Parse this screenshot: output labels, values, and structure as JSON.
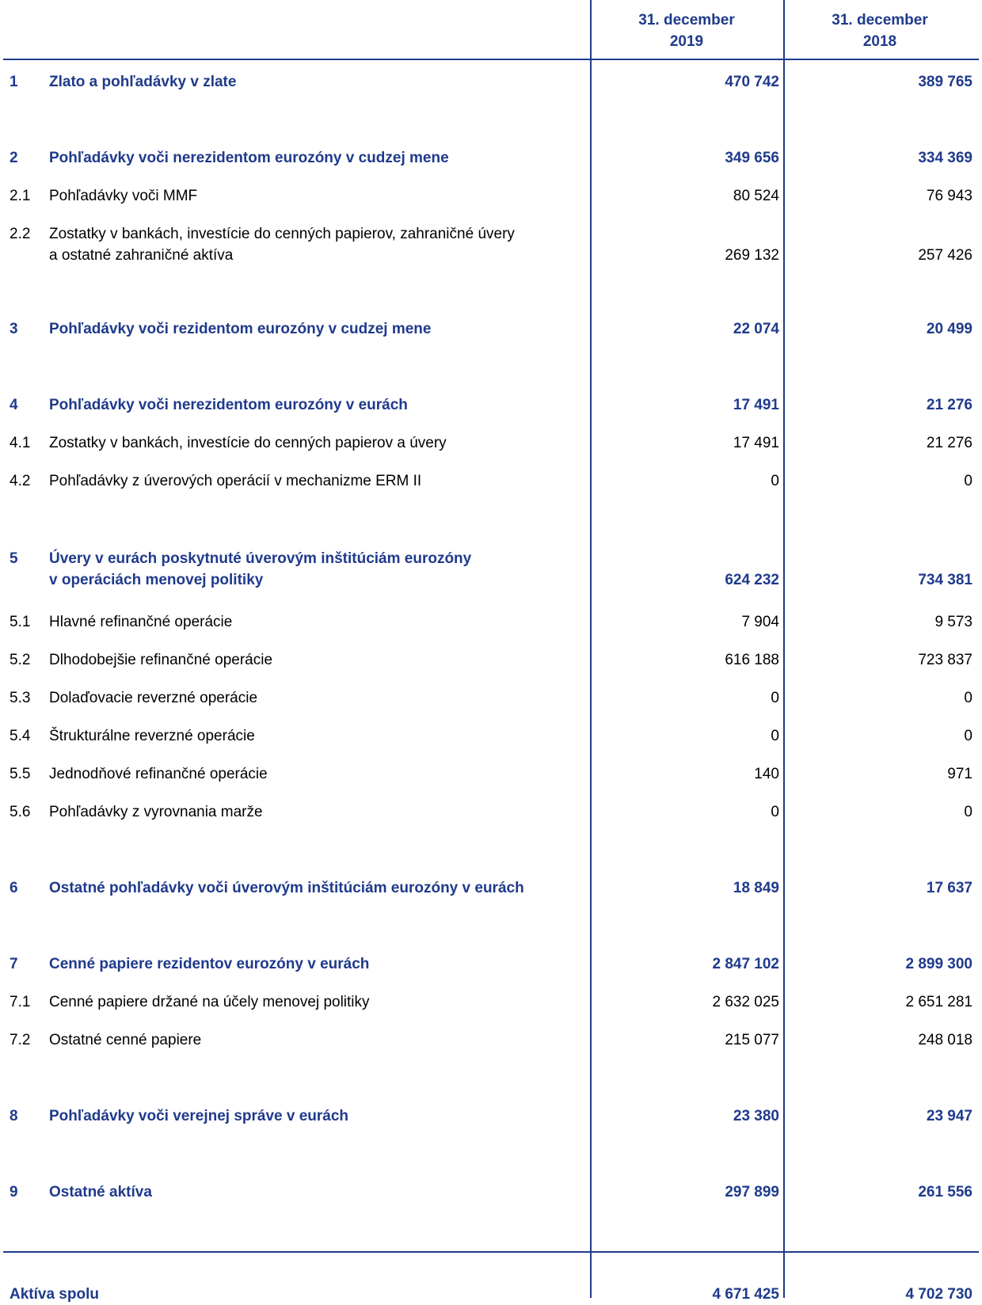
{
  "header": {
    "col2019": [
      "31. december",
      "2019"
    ],
    "col2018": [
      "31. december",
      "2018"
    ]
  },
  "rows": [
    {
      "num": "1",
      "label": [
        "Zlato a pohľadávky v zlate"
      ],
      "v2019": "470 742",
      "v2018": "389 765",
      "bold": true
    },
    {
      "num": "2",
      "label": [
        "Pohľadávky voči nerezidentom eurozóny v cudzej mene"
      ],
      "v2019": "349 656",
      "v2018": "334 369",
      "bold": true
    },
    {
      "num": "2.1",
      "label": [
        "Pohľadávky voči MMF"
      ],
      "v2019": "80 524",
      "v2018": "76 943",
      "bold": false
    },
    {
      "num": "2.2",
      "label": [
        "Zostatky v bankách, investície do cenných papierov, zahraničné úvery",
        "a ostatné zahraničné aktíva"
      ],
      "v2019": "269 132",
      "v2018": "257 426",
      "bold": false
    },
    {
      "num": "3",
      "label": [
        "Pohľadávky voči rezidentom eurozóny v cudzej mene"
      ],
      "v2019": "22 074",
      "v2018": "20 499",
      "bold": true
    },
    {
      "num": "4",
      "label": [
        "Pohľadávky voči nerezidentom eurozóny v eurách"
      ],
      "v2019": "17 491",
      "v2018": "21 276",
      "bold": true
    },
    {
      "num": "4.1",
      "label": [
        "Zostatky v bankách, investície do cenných papierov a úvery"
      ],
      "v2019": "17 491",
      "v2018": "21 276",
      "bold": false
    },
    {
      "num": "4.2",
      "label": [
        "Pohľadávky z úverových operácií v mechanizme ERM II"
      ],
      "v2019": "0",
      "v2018": "0",
      "bold": false
    },
    {
      "num": "5",
      "label": [
        "Úvery v eurách poskytnuté úverovým inštitúciám eurozóny",
        "v operáciách menovej politiky"
      ],
      "v2019": "624 232",
      "v2018": "734 381",
      "bold": true
    },
    {
      "num": "5.1",
      "label": [
        "Hlavné refinančné operácie"
      ],
      "v2019": "7 904",
      "v2018": "9 573",
      "bold": false
    },
    {
      "num": "5.2",
      "label": [
        "Dlhodobejšie refinančné operácie"
      ],
      "v2019": "616 188",
      "v2018": "723 837",
      "bold": false
    },
    {
      "num": "5.3",
      "label": [
        "Dolaďovacie reverzné operácie"
      ],
      "v2019": "0",
      "v2018": "0",
      "bold": false
    },
    {
      "num": "5.4",
      "label": [
        "Štrukturálne reverzné operácie"
      ],
      "v2019": "0",
      "v2018": "0",
      "bold": false
    },
    {
      "num": "5.5",
      "label": [
        "Jednodňové refinančné operácie"
      ],
      "v2019": "140",
      "v2018": "971",
      "bold": false
    },
    {
      "num": "5.6",
      "label": [
        "Pohľadávky z vyrovnania marže"
      ],
      "v2019": "0",
      "v2018": "0",
      "bold": false
    },
    {
      "num": "6",
      "label": [
        "Ostatné pohľadávky voči úverovým inštitúciám eurozóny v eurách"
      ],
      "v2019": "18 849",
      "v2018": "17 637",
      "bold": true
    },
    {
      "num": "7",
      "label": [
        "Cenné papiere rezidentov eurozóny v eurách"
      ],
      "v2019": "2 847 102",
      "v2018": "2 899 300",
      "bold": true
    },
    {
      "num": "7.1",
      "label": [
        "Cenné papiere držané na účely menovej politiky"
      ],
      "v2019": "2 632 025",
      "v2018": "2 651 281",
      "bold": false
    },
    {
      "num": "7.2",
      "label": [
        "Ostatné cenné papiere"
      ],
      "v2019": "215 077",
      "v2018": "248 018",
      "bold": false
    },
    {
      "num": "8",
      "label": [
        "Pohľadávky voči verejnej správe v eurách"
      ],
      "v2019": "23 380",
      "v2018": "23 947",
      "bold": true
    },
    {
      "num": "9",
      "label": [
        "Ostatné aktíva"
      ],
      "v2019": "297 899",
      "v2018": "261 556",
      "bold": true
    }
  ],
  "total": {
    "label": "Aktíva spolu",
    "v2019": "4 671 425",
    "v2018": "4 702 730"
  }
}
